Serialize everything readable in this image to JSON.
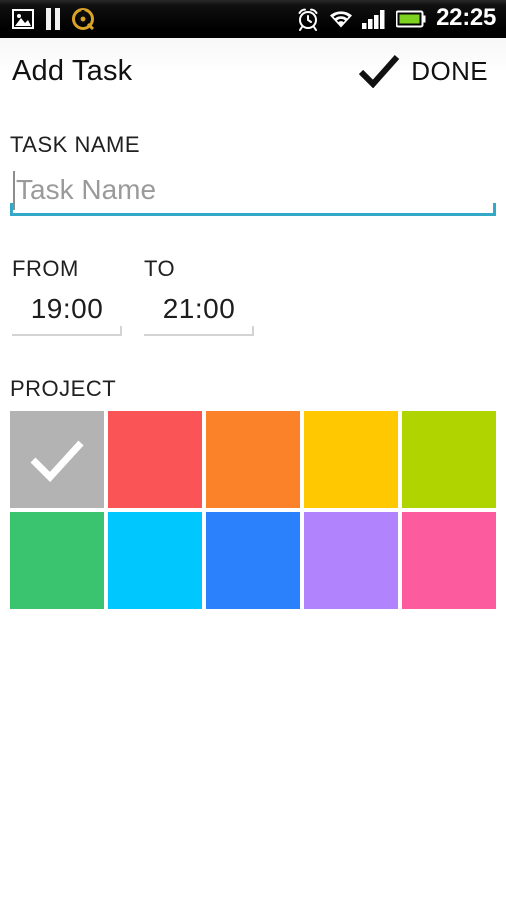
{
  "status_bar": {
    "left_icons": [
      {
        "name": "gallery-image-icon",
        "label": "Gallery"
      },
      {
        "name": "pause-media-icon",
        "label": "Pause"
      },
      {
        "name": "compass-sync-icon",
        "label": "Sync"
      }
    ],
    "right_icons": [
      {
        "name": "alarm-clock-icon",
        "label": "Alarm"
      },
      {
        "name": "wifi-icon",
        "label": "Wi-Fi"
      },
      {
        "name": "cellular-signal-icon",
        "label": "Signal"
      },
      {
        "name": "battery-icon",
        "label": "Battery"
      }
    ],
    "time": "22:25",
    "battery_color": "#7ED321",
    "background": "#000000"
  },
  "action_bar": {
    "title": "Add Task",
    "done_label": "DONE",
    "done_icon": "check-icon"
  },
  "task_name": {
    "label": "TASK NAME",
    "value": "",
    "placeholder": "Task Name",
    "underline_color": "#33A8C7"
  },
  "time_range": {
    "from": {
      "label": "FROM",
      "value": "19:00"
    },
    "to": {
      "label": "TO",
      "value": "21:00"
    },
    "underline_color": "#D3D3D3"
  },
  "project": {
    "label": "PROJECT",
    "selected_index": 0,
    "check_icon": "check-icon",
    "swatches": [
      {
        "name": "swatch-gray",
        "color": "#B3B3B3",
        "selected": true
      },
      {
        "name": "swatch-red",
        "color": "#FB5457",
        "selected": false
      },
      {
        "name": "swatch-orange",
        "color": "#FC822A",
        "selected": false
      },
      {
        "name": "swatch-yellow",
        "color": "#FFC800",
        "selected": false
      },
      {
        "name": "swatch-lime",
        "color": "#AFD400",
        "selected": false
      },
      {
        "name": "swatch-green",
        "color": "#3BC470",
        "selected": false
      },
      {
        "name": "swatch-cyan",
        "color": "#00C8FF",
        "selected": false
      },
      {
        "name": "swatch-blue",
        "color": "#2B80FB",
        "selected": false
      },
      {
        "name": "swatch-purple",
        "color": "#B183FC",
        "selected": false
      },
      {
        "name": "swatch-pink",
        "color": "#FC5B9D",
        "selected": false
      }
    ]
  }
}
